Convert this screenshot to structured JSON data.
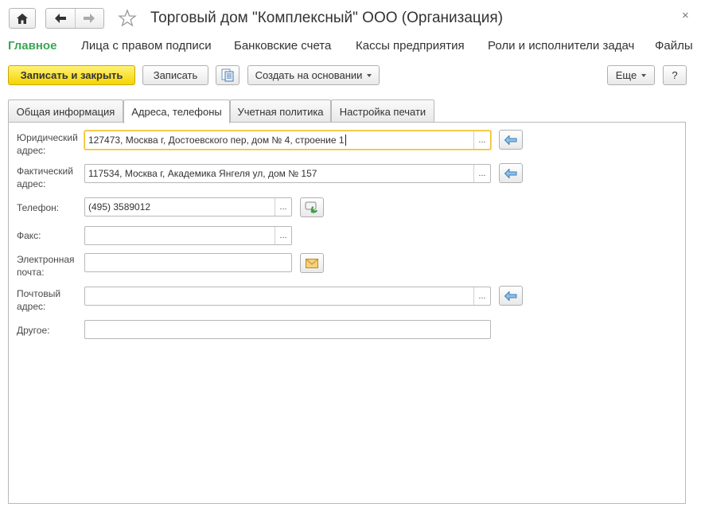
{
  "window": {
    "title": "Торговый дом \"Комплексный\" ООО (Организация)",
    "icons": {
      "home": "home-icon",
      "back": "arrow-left-icon",
      "forward": "arrow-right-icon",
      "favorite": "star-icon",
      "close": "close-icon"
    },
    "close_glyph": "×"
  },
  "sections": [
    {
      "label": "Главное",
      "active": true
    },
    {
      "label": "Лица с правом подписи"
    },
    {
      "label": "Банковские счета"
    },
    {
      "label": "Кассы предприятия"
    },
    {
      "label": "Роли и исполнители задач"
    },
    {
      "label": "Файлы"
    }
  ],
  "toolbar": {
    "save_close_label": "Записать и закрыть",
    "save_label": "Записать",
    "create_based_label": "Создать на основании",
    "more_label": "Еще",
    "help_label": "?"
  },
  "tabs": [
    {
      "label": "Общая информация"
    },
    {
      "label": "Адреса, телефоны",
      "active": true
    },
    {
      "label": "Учетная политика"
    },
    {
      "label": "Настройка печати"
    }
  ],
  "form": {
    "legal_address": {
      "label_line1": "Юридический",
      "label_line2": "адрес:",
      "value": "127473, Москва г, Достоевского пер, дом № 4, строение 1"
    },
    "actual_address": {
      "label_line1": "Фактический",
      "label_line2": "адрес:",
      "value": "117534, Москва г, Академика Янгеля ул, дом № 157"
    },
    "phone": {
      "label": "Телефон:",
      "value": "(495) 3589012"
    },
    "fax": {
      "label": "Факс:",
      "value": ""
    },
    "email": {
      "label_line1": "Электронная",
      "label_line2": "почта:",
      "value": ""
    },
    "postal_address": {
      "label_line1": "Почтовый",
      "label_line2": "адрес:",
      "value": ""
    },
    "other": {
      "label": "Другое:",
      "value": ""
    },
    "select_glyph": "..."
  },
  "colors": {
    "accent_green": "#3aa655",
    "primary_yellow": "#f5d400",
    "focus_border": "#f0c030"
  }
}
